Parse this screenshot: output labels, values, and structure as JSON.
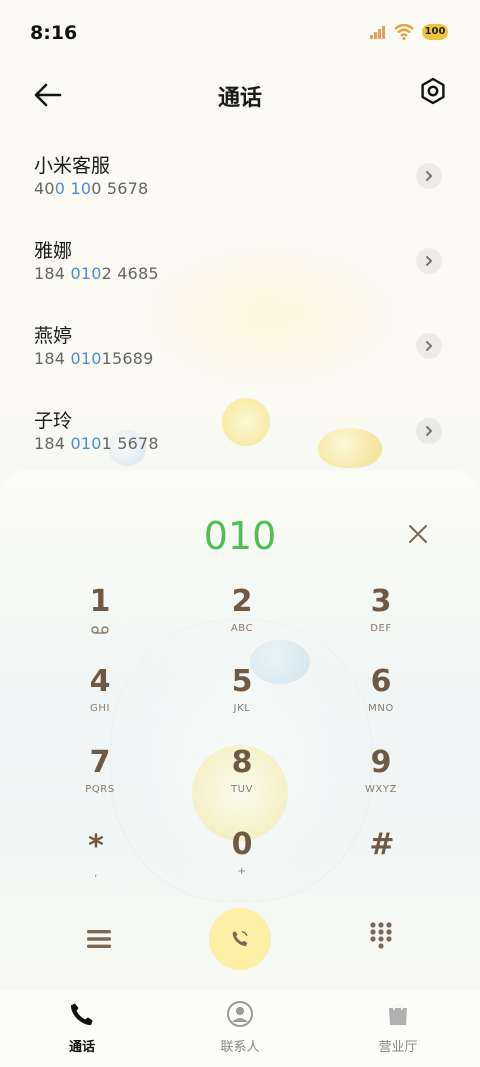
{
  "status_bar": {
    "time": "8:16",
    "battery": "100"
  },
  "header": {
    "title": "通话"
  },
  "contacts": [
    {
      "name": "小米客服",
      "number_parts": [
        {
          "text": "40",
          "hl": false
        },
        {
          "text": "0",
          "hl": true
        },
        {
          "text": " ",
          "hl": false
        },
        {
          "text": "10",
          "hl": true
        },
        {
          "text": "0 5678",
          "hl": false
        }
      ]
    },
    {
      "name": "雅娜",
      "number_parts": [
        {
          "text": "184 ",
          "hl": false
        },
        {
          "text": "010",
          "hl": true
        },
        {
          "text": "2 4685",
          "hl": false
        }
      ]
    },
    {
      "name": "燕婷",
      "number_parts": [
        {
          "text": "184 ",
          "hl": false
        },
        {
          "text": "010",
          "hl": true
        },
        {
          "text": "15689",
          "hl": false
        }
      ]
    },
    {
      "name": "子玲",
      "number_parts": [
        {
          "text": "184 ",
          "hl": false
        },
        {
          "text": "010",
          "hl": true
        },
        {
          "text": "1 5678",
          "hl": false
        }
      ]
    }
  ],
  "dialer": {
    "entered_number": "010",
    "keys": [
      {
        "digit": "1",
        "letters": ""
      },
      {
        "digit": "2",
        "letters": "ABC"
      },
      {
        "digit": "3",
        "letters": "DEF"
      },
      {
        "digit": "4",
        "letters": "GHI"
      },
      {
        "digit": "5",
        "letters": "JKL"
      },
      {
        "digit": "6",
        "letters": "MNO"
      },
      {
        "digit": "7",
        "letters": "PQRS"
      },
      {
        "digit": "8",
        "letters": "TUV"
      },
      {
        "digit": "9",
        "letters": "WXYZ"
      },
      {
        "digit": "*",
        "letters": ","
      },
      {
        "digit": "0",
        "letters": "+"
      },
      {
        "digit": "#",
        "letters": ""
      }
    ]
  },
  "bottom_nav": {
    "items": [
      {
        "label": "通话",
        "icon": "phone-icon",
        "active": true
      },
      {
        "label": "联系人",
        "icon": "person-icon",
        "active": false
      },
      {
        "label": "营业厅",
        "icon": "shopping-bag-icon",
        "active": false
      }
    ]
  },
  "colors": {
    "accent_green": "#4cc14f",
    "highlight_blue": "#4a8fd6",
    "key_brown": "#6e5a44",
    "call_button": "#fbf0a6"
  }
}
